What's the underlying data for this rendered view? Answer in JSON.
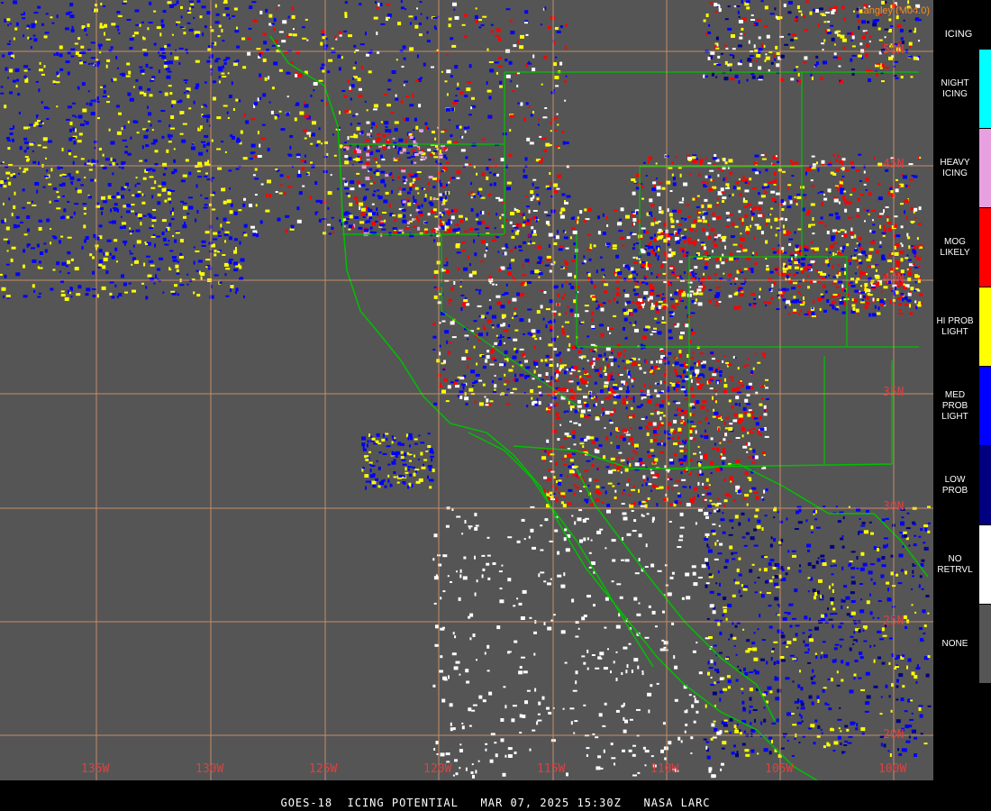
{
  "product": {
    "credit": "Langley (M04.0)",
    "caption": "GOES-18  ICING POTENTIAL   MAR 07, 2025 15:30Z   NASA LARC"
  },
  "lat_labels": [
    "50N",
    "45N",
    "40N",
    "35N",
    "30N",
    "25N",
    "20N"
  ],
  "lon_labels": [
    "135W",
    "130W",
    "125W",
    "120W",
    "115W",
    "110W",
    "105W",
    "100W"
  ],
  "legend": {
    "title": "ICING",
    "items": [
      {
        "label": "NIGHT\nICING",
        "color": "#00ffff"
      },
      {
        "label": "HEAVY\nICING",
        "color": "#e8a0e0"
      },
      {
        "label": "MOG\nLIKELY",
        "color": "#ff0000"
      },
      {
        "label": "HI PROB\nLIGHT",
        "color": "#ffff00"
      },
      {
        "label": "MED PROB\nLIGHT",
        "color": "#0000ff"
      },
      {
        "label": "LOW\nPROB",
        "color": "#000080"
      },
      {
        "label": "NO\nRETRVL",
        "color": "#ffffff"
      },
      {
        "label": "NONE",
        "color": "#555555"
      }
    ]
  },
  "colors": {
    "background": "#555555",
    "gridline": "#e8a070",
    "coastline": "#00c000",
    "label": "#e04040"
  }
}
